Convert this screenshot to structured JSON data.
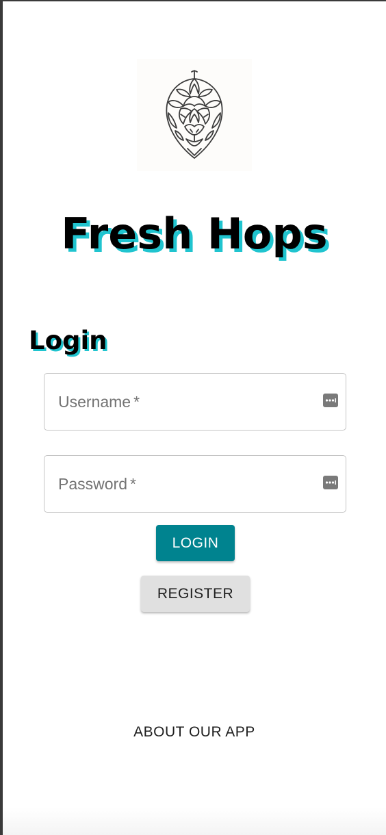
{
  "app": {
    "title": "Fresh Hops",
    "logo_icon": "hop-cone-icon"
  },
  "login": {
    "heading": "Login",
    "username": {
      "label": "Username",
      "required_mark": "*",
      "value": "",
      "icon": "password-manager-key-icon"
    },
    "password": {
      "label": "Password",
      "required_mark": "*",
      "value": "",
      "icon": "password-manager-key-icon"
    },
    "login_button": "LOGIN",
    "register_button": "REGISTER"
  },
  "footer": {
    "about_link": "ABOUT OUR APP"
  },
  "colors": {
    "accent": "#00838f",
    "title_shadow": "#20c4cf",
    "secondary_button": "#e0e0e0"
  }
}
